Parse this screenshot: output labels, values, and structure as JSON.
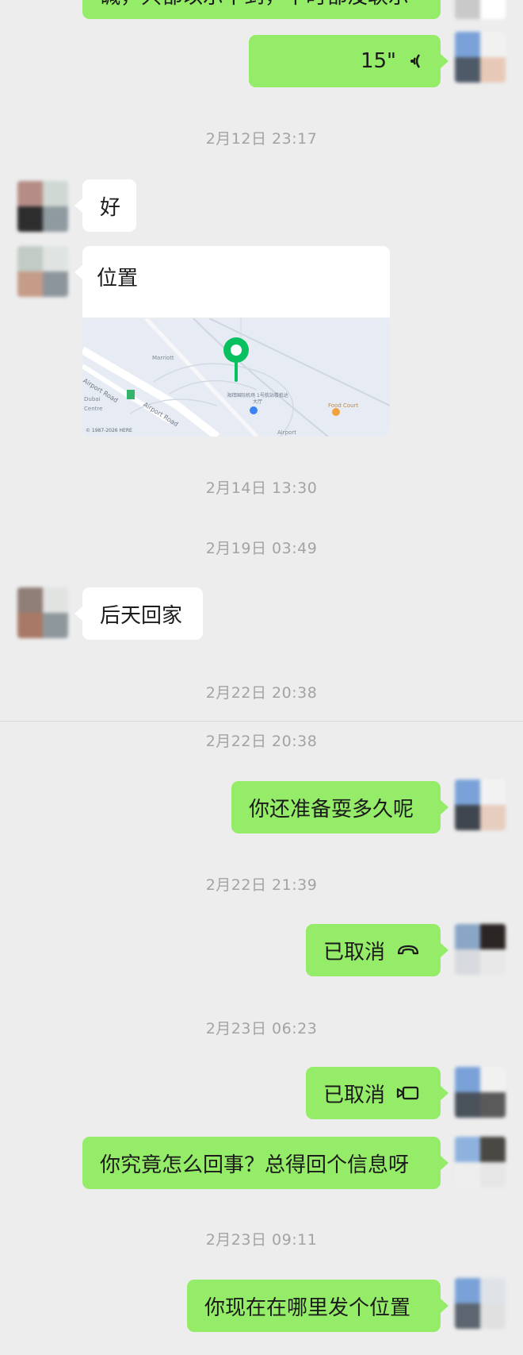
{
  "top_partial_text": "碱，只都以示干到，干时都没联示",
  "messages": {
    "voice_duration": "15\"",
    "reply_good": "好",
    "location_label": "位置",
    "map": {
      "label_1": "Marriott",
      "label_2": "Airport Road",
      "label_3": "Airport Road",
      "label_4": "海拜国际机场 1号航站楼抵达大厅",
      "label_5": "Food Court",
      "label_6": "© 1987-2026 HERE",
      "label_7": "Airport",
      "label_8": "Centre",
      "label_9": "Dubai"
    },
    "back_day_after": "后天回家",
    "how_long": "你还准备耍多久呢",
    "cancelled_1": "已取消",
    "cancelled_2": "已取消",
    "whats_going_on": "你究竟怎么回事？总得回个信息呀",
    "where_are_you": "你现在在哪里发个位置"
  },
  "timestamps": {
    "t1": "2月12日 23:17",
    "t2": "2月14日 13:30",
    "t3": "2月19日 03:49",
    "t4": "2月22日 20:38",
    "t5": "2月22日 20:38",
    "t6": "2月22日 21:39",
    "t7": "2月23日 06:23",
    "t8": "2月23日 09:11"
  },
  "colors": {
    "background": "#ededed",
    "sent_bubble": "#95ec69",
    "received_bubble": "#ffffff",
    "timestamp_text": "#a3a3a3",
    "map_pin": "#07c160"
  },
  "icons": {
    "voice": "voice-wave-icon",
    "voice_call_cancel": "phone-hangup-icon",
    "video_call_cancel": "video-call-icon",
    "map_pin": "map-pin-icon"
  }
}
